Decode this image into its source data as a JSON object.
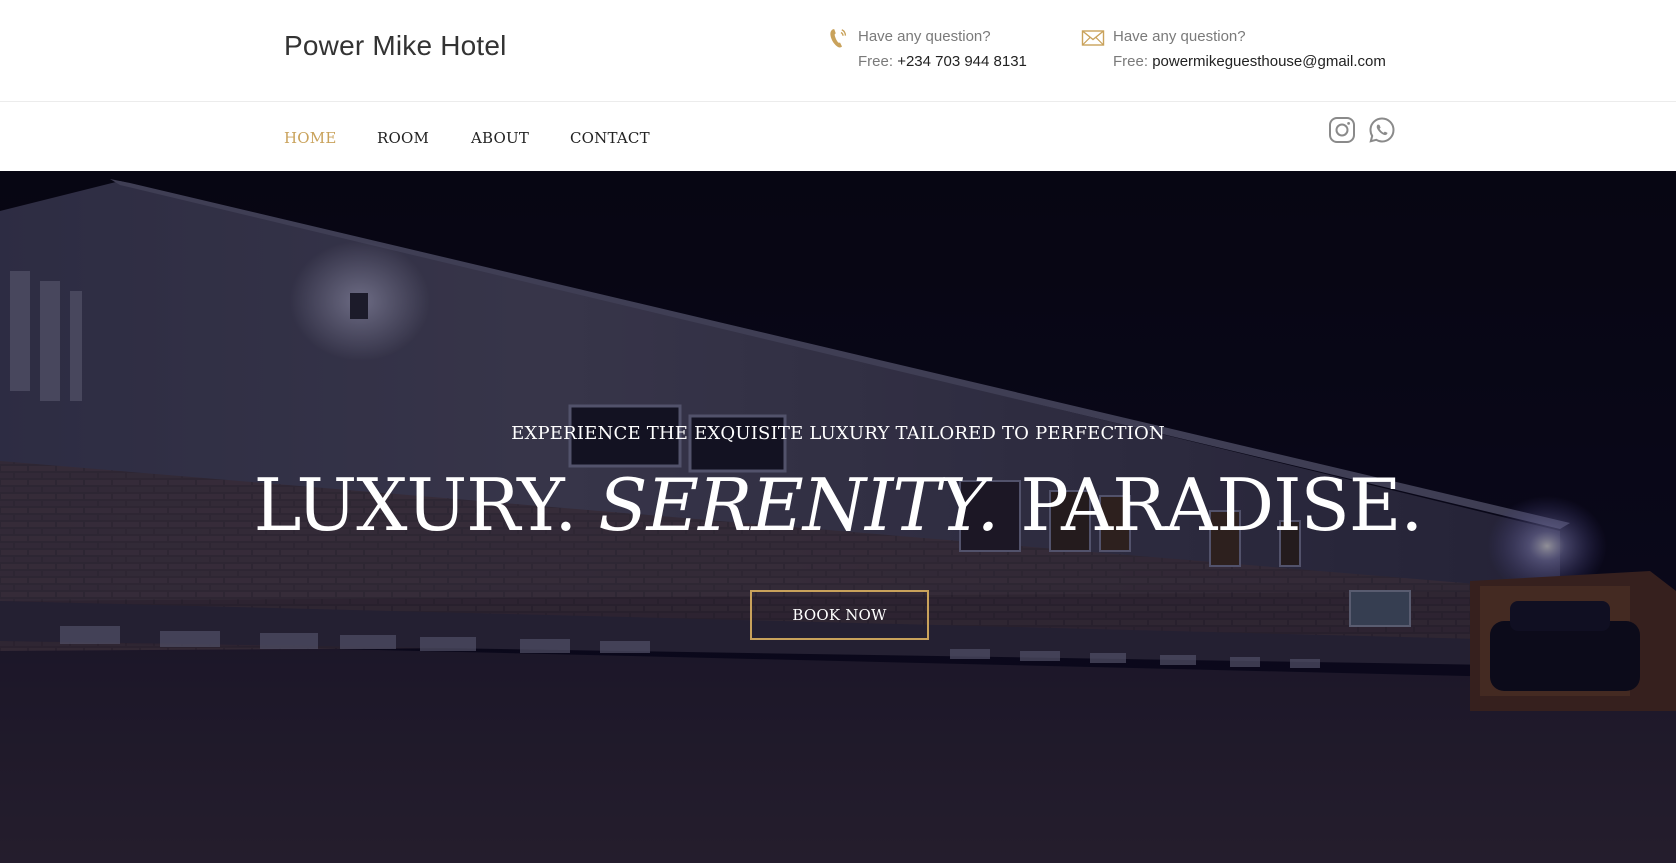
{
  "header": {
    "brand": "Power Mike Hotel",
    "phone": {
      "icon": "phone-icon",
      "question": "Have any question?",
      "prefix": "Free:",
      "value": "+234 703 944 8131"
    },
    "email": {
      "icon": "mail-icon",
      "question": "Have any question?",
      "prefix": "Free:",
      "value": "powermikeguesthouse@gmail.com"
    }
  },
  "nav": {
    "items": [
      {
        "label": "HOME",
        "active": true
      },
      {
        "label": "ROOM",
        "active": false
      },
      {
        "label": "ABOUT",
        "active": false
      },
      {
        "label": "CONTACT",
        "active": false
      }
    ],
    "social": [
      "instagram-icon",
      "whatsapp-icon"
    ]
  },
  "hero": {
    "subtitle": "EXPERIENCE THE EXQUISITE LUXURY TAILORED TO PERFECTION",
    "title_part1": "LUXURY. ",
    "title_part2": "SERENITY.",
    "title_part3": " PARADISE.",
    "button": "BOOK NOW"
  },
  "colors": {
    "accent": "#c9a25b",
    "text_dark": "#222222",
    "text_muted": "#7a7a7a"
  }
}
